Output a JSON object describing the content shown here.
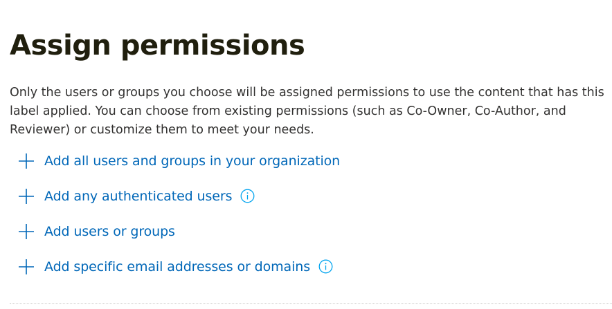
{
  "page": {
    "title": "Assign permissions",
    "description": "Only the users or groups you choose will be assigned permissions to use the content that has this label applied. You can choose from existing permissions (such as Co-Owner, Co-Author, and Reviewer) or customize them to meet your needs."
  },
  "actions": [
    {
      "label": "Add all users and groups in your organization",
      "info": false
    },
    {
      "label": "Add any authenticated users",
      "info": true
    },
    {
      "label": "Add users or groups",
      "info": false
    },
    {
      "label": "Add specific email addresses or domains",
      "info": true
    }
  ],
  "colors": {
    "title": "#201f0e",
    "text": "#323130",
    "link": "#0067b8",
    "info_icon": "#00a4ef"
  },
  "icons": {
    "add": "plus-icon",
    "info": "info-icon"
  }
}
